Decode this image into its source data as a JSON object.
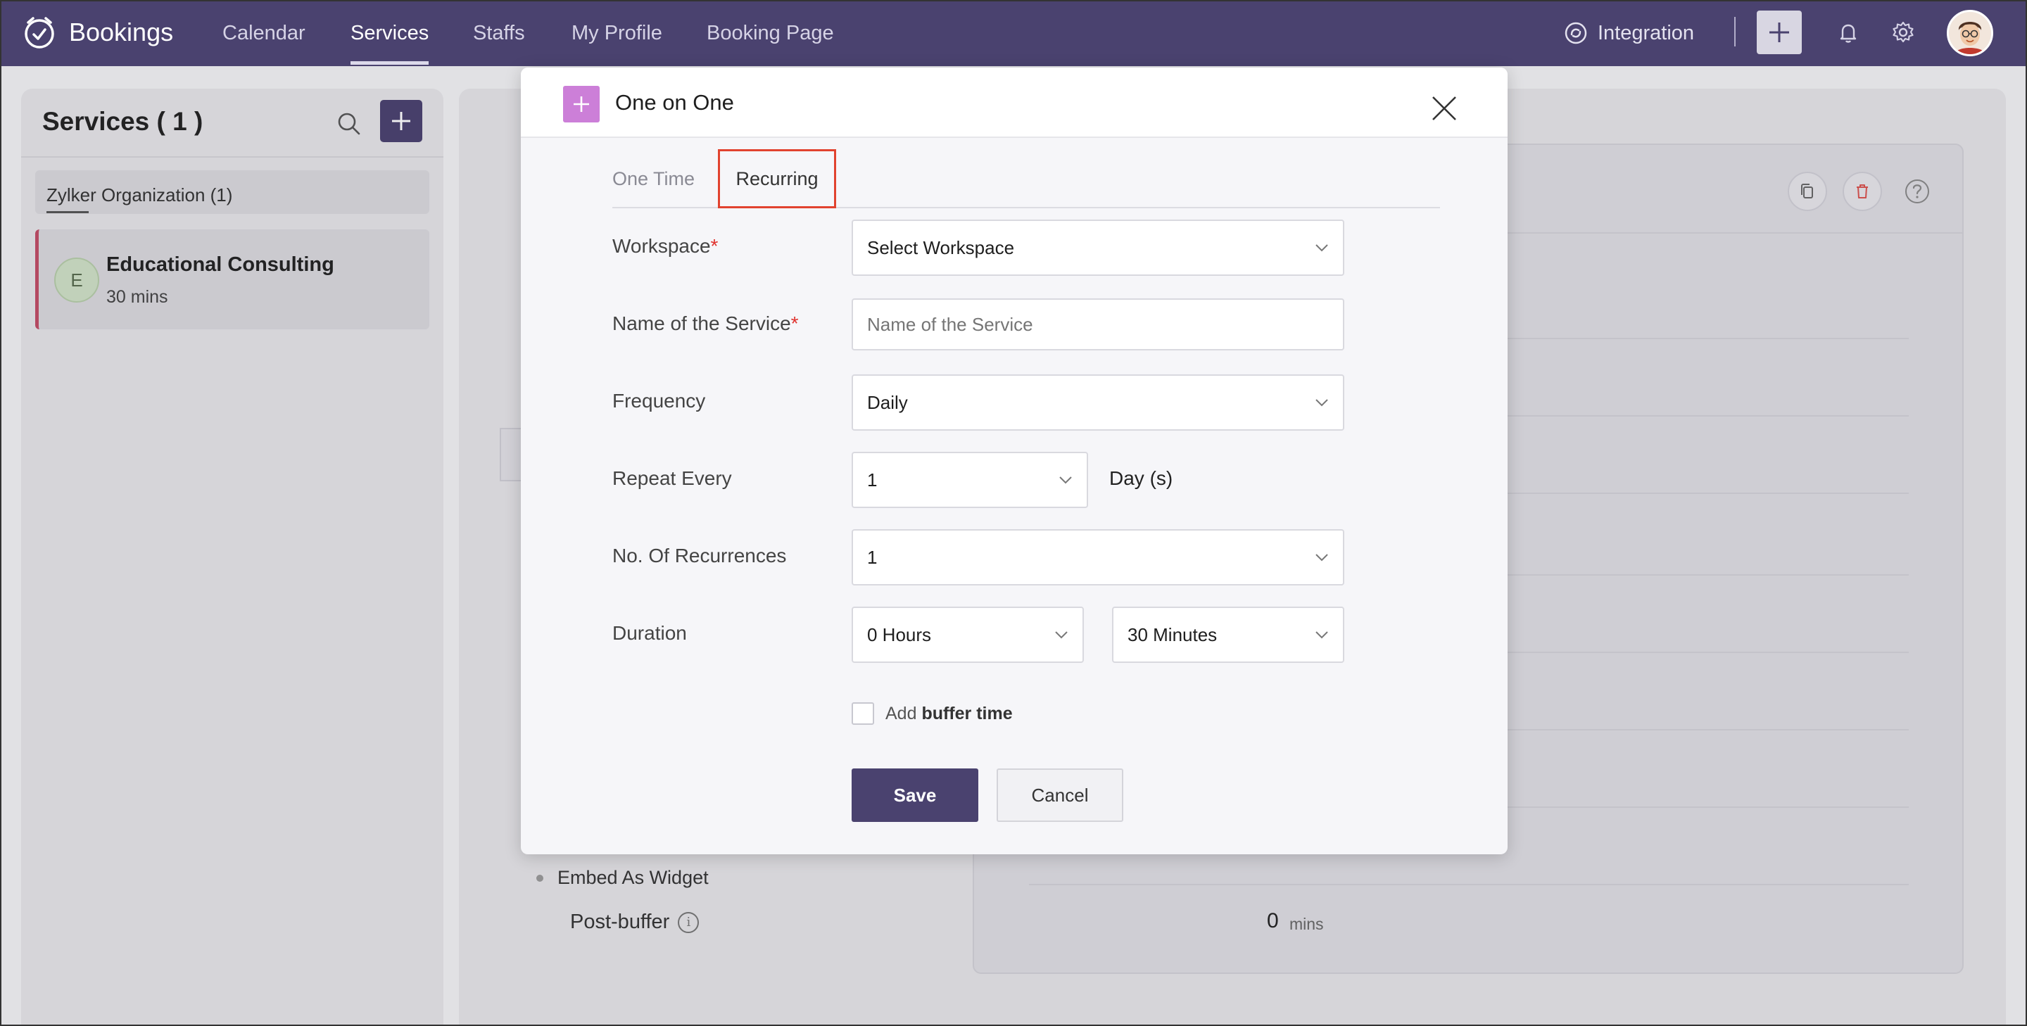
{
  "nav": {
    "brand": "Bookings",
    "items": [
      "Calendar",
      "Services",
      "Staffs",
      "My Profile",
      "Booking Page"
    ],
    "active": "Services",
    "integration": "Integration"
  },
  "services_panel": {
    "title": "Services ( 1 )",
    "org_tab": "Zylker Organization (1)",
    "service": {
      "initial": "E",
      "name": "Educational Consulting",
      "duration": "30 mins"
    }
  },
  "details": {
    "embed_link": "Embed As Widget",
    "post_buffer_label": "Post-buffer",
    "post_buffer_value": "0",
    "post_buffer_unit": "mins"
  },
  "modal": {
    "title": "One on One",
    "tabs": [
      "One Time",
      "Recurring"
    ],
    "selected_tab": "Recurring",
    "fields": {
      "workspace": {
        "label": "Workspace",
        "required_mark": "*",
        "value": "Select Workspace"
      },
      "service_name": {
        "label": "Name of the Service",
        "required_mark": "*",
        "placeholder": "Name of the Service",
        "value": ""
      },
      "frequency": {
        "label": "Frequency",
        "value": "Daily"
      },
      "repeat_every": {
        "label": "Repeat Every",
        "value": "1",
        "unit": "Day (s)"
      },
      "recurrences": {
        "label": "No. Of Recurrences",
        "value": "1"
      },
      "duration": {
        "label": "Duration",
        "hours": "0 Hours",
        "minutes": "30 Minutes"
      }
    },
    "buffer": {
      "prefix": "Add",
      "bold": "buffer time",
      "checked": false
    },
    "save_label": "Save",
    "cancel_label": "Cancel"
  },
  "colors": {
    "nav_bg": "#4a426f",
    "primary": "#4a426f",
    "highlight": "#e1432f",
    "required": "#e0332f",
    "service_type_icon": "#cc7fd8",
    "service_accent": "#c14c65"
  },
  "icons": {
    "brand": "clock-check-icon",
    "integration": "integration-icon",
    "add": "plus-icon",
    "notifications": "bell-icon",
    "settings": "gear-icon",
    "search": "search-icon",
    "close": "close-icon",
    "copy": "copy-icon",
    "delete": "trash-icon",
    "help": "help-icon",
    "info": "info-icon",
    "dropdown": "chevron-down-icon"
  }
}
